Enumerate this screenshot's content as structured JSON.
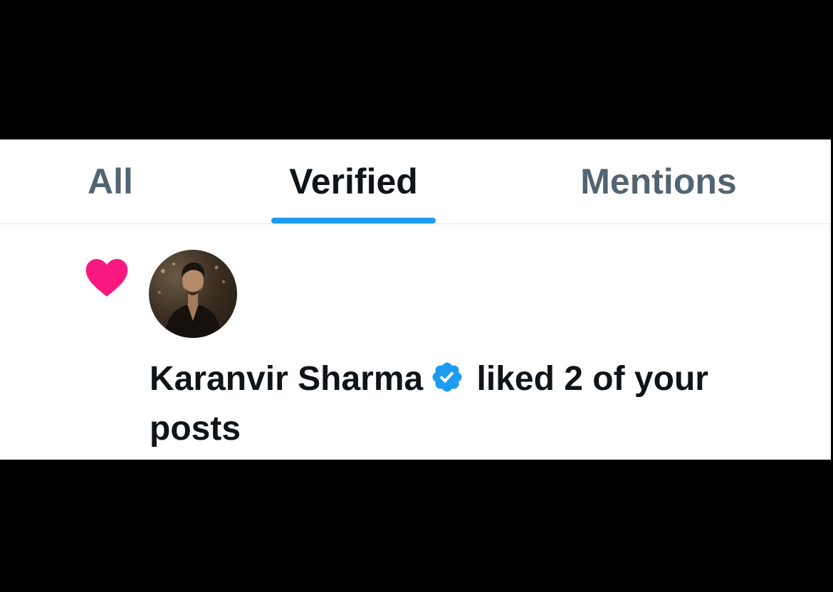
{
  "tabs": {
    "all": "All",
    "verified": "Verified",
    "mentions": "Mentions",
    "active": "Verified"
  },
  "notification": {
    "type_icon": "heart-icon",
    "user_name": "Karanvir Sharma",
    "badge_icon": "verified-badge-icon",
    "action_text": "liked 2 of your posts"
  },
  "colors": {
    "accent": "#1d9bf0",
    "heart": "#f91880",
    "text_primary": "#0f1419",
    "text_secondary": "#536471"
  }
}
